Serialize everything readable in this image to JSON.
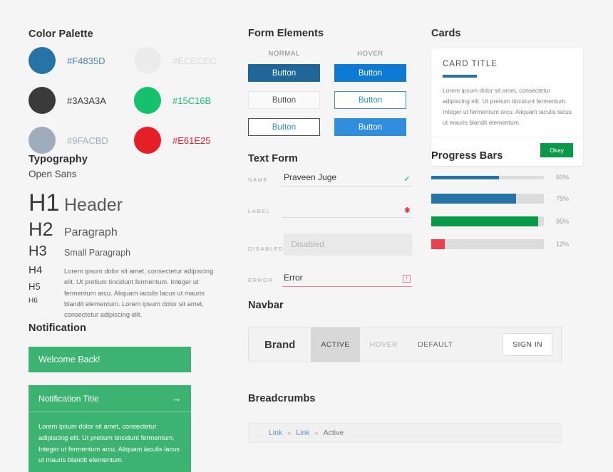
{
  "palette": {
    "title": "Color Palette",
    "swatches": [
      {
        "color": "#2573a7",
        "label": "#F4835D",
        "label_color": "#4a86b8"
      },
      {
        "color": "#ececec",
        "label": "#ECECEC",
        "label_color": "#d8d8d8"
      },
      {
        "color": "#3a3a3a",
        "label": "#3A3A3A",
        "label_color": "#3a3a3a"
      },
      {
        "color": "#15c16b",
        "label": "#15C16B",
        "label_color": "#15c16b"
      },
      {
        "color": "#9facbd",
        "label": "#9FACBD",
        "label_color": "#9facbd"
      },
      {
        "color": "#e61e25",
        "label": "#E61E25",
        "label_color": "#e61e25"
      }
    ]
  },
  "typography": {
    "title": "Typography",
    "font_name": "Open Sans",
    "h1_tag": "H1",
    "h1_sample": "Header",
    "h2_tag": "H2",
    "h2_sample": "Paragraph",
    "h3_tag": "H3",
    "h3_sample": "Small Paragraph",
    "h4_tag": "H4",
    "h5_tag": "H5",
    "h6_tag": "H6",
    "lorem": "Lorem ipsum dolor sit amet, consectetur adipiscing elit. Ut pretium tincidunt fermentum. Integer ut fermentum arcu. Aliquam iaculis lacus ut mauris blandit elementum. Lorem ipsum dolor sit amet, consectetur adipiscing elit."
  },
  "notification": {
    "title": "Notification",
    "simple_text": "Welcome Back!",
    "card_title": "Notification Title",
    "arrow_icon": "→",
    "card_body": "Lorem ipsum dolor sit amet, consectetur adipiscing elit. Ut pretium tincidunt fermentum. Integer ut fermentum arcu. Aliquam iaculis lacus ut mauris blandit elementum."
  },
  "form_elements": {
    "title": "Form Elements",
    "col_normal": "NORMAL",
    "col_hover": "HOVER",
    "button_label": "Button"
  },
  "text_form": {
    "title": "Text Form",
    "rows": [
      {
        "label": "NAME",
        "value": "Praveen Juge",
        "placeholder": "",
        "icon": "✓"
      },
      {
        "label": "LABEL",
        "value": "",
        "placeholder": "",
        "icon": "✱"
      },
      {
        "label": "DISABLED",
        "value": "",
        "placeholder": "Disabled",
        "icon": ""
      },
      {
        "label": "ERROR",
        "value": "Error",
        "placeholder": "",
        "icon": "!"
      }
    ]
  },
  "navbar": {
    "title": "Navbar",
    "brand": "Brand",
    "items": [
      {
        "label": "ACTIVE"
      },
      {
        "label": "HOVER"
      },
      {
        "label": "DEFAULT"
      }
    ],
    "signin_label": "SIGN IN"
  },
  "breadcrumbs": {
    "title": "Breadcrumbs",
    "items": [
      {
        "label": "Link",
        "type": "link"
      },
      {
        "label": "Link",
        "type": "link"
      },
      {
        "label": "Active",
        "type": "active"
      }
    ],
    "separator": "»"
  },
  "cards": {
    "title": "Cards",
    "card_title": "CARD TITLE",
    "card_text": "Lorem ipsum dolor sit amet, consectetur adipiscing elit. Ut pretium tincidunt fermentum. Integer ut fermentum arcu. Aliquam iaculis lacus ut mauris blandit elementum.",
    "card_button": "Okay",
    "accent_color": "#2573a7",
    "button_color": "#089949"
  },
  "progress": {
    "title": "Progress Bars",
    "bars": [
      {
        "percent": 60,
        "label": "60%",
        "color": "#2573a7",
        "size": "thin"
      },
      {
        "percent": 75,
        "label": "75%",
        "color": "#2573a7",
        "size": "thick"
      },
      {
        "percent": 95,
        "label": "95%",
        "color": "#089949",
        "size": "thick"
      },
      {
        "percent": 12,
        "label": "12%",
        "color": "#e8414b",
        "size": "thick"
      }
    ]
  }
}
